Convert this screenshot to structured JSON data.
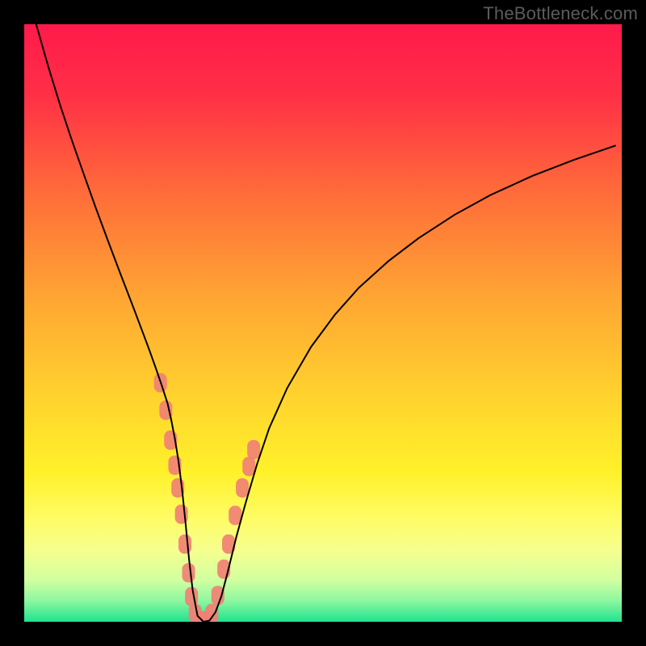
{
  "watermark": "TheBottleneck.com",
  "chart_data": {
    "type": "line",
    "title": "",
    "xlabel": "",
    "ylabel": "",
    "xlim": [
      0,
      100
    ],
    "ylim": [
      0,
      100
    ],
    "grid": false,
    "legend": false,
    "background_gradient": {
      "stops": [
        {
          "offset": 0.0,
          "color": "#ff1a4b"
        },
        {
          "offset": 0.12,
          "color": "#ff3046"
        },
        {
          "offset": 0.28,
          "color": "#ff6b3a"
        },
        {
          "offset": 0.45,
          "color": "#ffa333"
        },
        {
          "offset": 0.62,
          "color": "#ffd22e"
        },
        {
          "offset": 0.75,
          "color": "#fff12a"
        },
        {
          "offset": 0.82,
          "color": "#fffb60"
        },
        {
          "offset": 0.88,
          "color": "#f6ff8e"
        },
        {
          "offset": 0.93,
          "color": "#d2ffa0"
        },
        {
          "offset": 0.965,
          "color": "#8cf7a0"
        },
        {
          "offset": 1.0,
          "color": "#1fe28f"
        }
      ]
    },
    "series": [
      {
        "name": "curve",
        "color": "#000000",
        "stroke_width": 2,
        "x": [
          2,
          4,
          6,
          8,
          10,
          12,
          14,
          16,
          18,
          20,
          21,
          22,
          23,
          24,
          24.6,
          25.2,
          25.8,
          26.4,
          27,
          27.6,
          28.2,
          29,
          30,
          31,
          32,
          33,
          34,
          35.5,
          37,
          39,
          41,
          44,
          48,
          52,
          56,
          61,
          66,
          72,
          78,
          85,
          92,
          99
        ],
        "y": [
          100,
          93,
          86.5,
          80.5,
          74.8,
          69.2,
          63.8,
          58.5,
          53.3,
          48,
          45.3,
          42.5,
          39.6,
          36.5,
          33.8,
          30.7,
          27,
          22.3,
          16.5,
          10.3,
          5.2,
          1,
          0,
          0.2,
          1.6,
          4.3,
          8.1,
          14.2,
          19.7,
          26.5,
          32.4,
          39.1,
          46,
          51.4,
          55.9,
          60.4,
          64.2,
          68.1,
          71.4,
          74.6,
          77.3,
          79.7
        ]
      },
      {
        "name": "marker-clusters",
        "type": "scatter",
        "color": "#f08174",
        "marker_radius": 8,
        "x": [
          22.8,
          23.7,
          24.5,
          25.2,
          25.7,
          26.3,
          26.9,
          27.5,
          28.0,
          28.6,
          29.4,
          30.0,
          30.6,
          31.4,
          32.4,
          33.4,
          34.2,
          35.3,
          36.5,
          37.6,
          38.4
        ],
        "y": [
          40.0,
          35.4,
          30.4,
          26.2,
          22.4,
          18.0,
          13.0,
          8.2,
          4.2,
          1.4,
          0.2,
          0.0,
          0.3,
          1.4,
          4.4,
          8.8,
          13.0,
          17.8,
          22.4,
          26.0,
          28.8
        ]
      }
    ]
  }
}
